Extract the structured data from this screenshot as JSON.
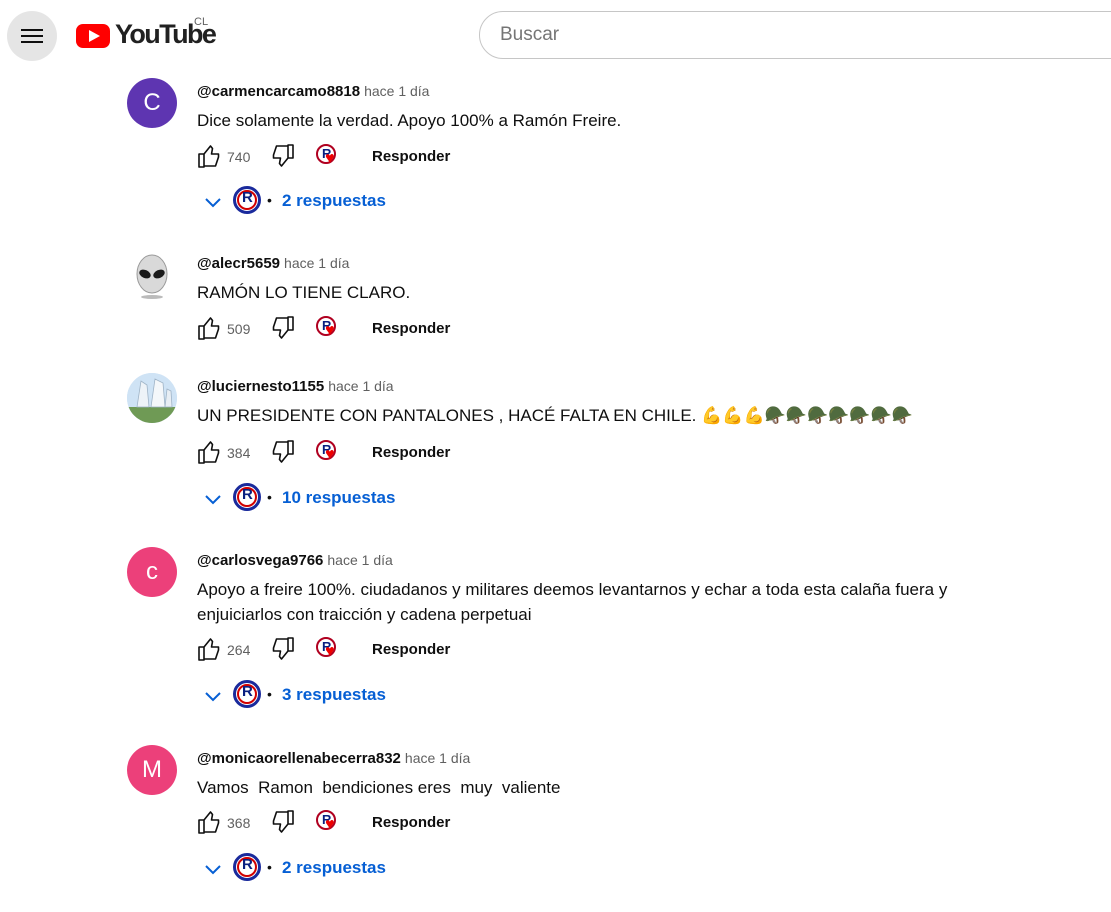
{
  "header": {
    "logo_text": "YouTube",
    "country_code": "CL",
    "search_placeholder": "Buscar"
  },
  "reply_button_label": "Responder",
  "icons": {
    "menu": "hamburger-icon",
    "like": "thumbs-up-icon",
    "dislike": "thumbs-down-icon",
    "creator_heart": "creator-heart-icon",
    "expand": "chevron-down-icon"
  },
  "colors": {
    "link": "#065fd4",
    "brand_red": "#ff0000",
    "avatar_purple": "#5e35b1",
    "avatar_pink": "#ec407a"
  },
  "comments": [
    {
      "author": "@carmencarcamo8818",
      "time": "hace 1 día",
      "avatar_letter": "C",
      "text": "Dice solamente la verdad. Apoyo 100% a Ramón Freire.",
      "likes": "740",
      "replies_label": "2 respuestas"
    },
    {
      "author": "@alecr5659",
      "time": "hace 1 día",
      "avatar_letter": "",
      "text": "RAMÓN LO TIENE CLARO.",
      "likes": "509",
      "replies_label": ""
    },
    {
      "author": "@luciernesto1155",
      "time": "hace 1 día",
      "avatar_letter": "",
      "text": "UN PRESIDENTE CON PANTALONES , HACÉ FALTA EN CHILE. 💪💪💪🪖🪖🪖🪖🪖🪖🪖",
      "likes": "384",
      "replies_label": "10 respuestas"
    },
    {
      "author": "@carlosvega9766",
      "time": "hace 1 día",
      "avatar_letter": "c",
      "text": "Apoyo a freire 100%. ciudadanos y militares deemos levantarnos y echar a toda esta calaña fuera y enjuiciarlos con traicción y cadena perpetuai",
      "likes": "264",
      "replies_label": "3 respuestas"
    },
    {
      "author": "@monicaorellenabecerra832",
      "time": "hace 1 día",
      "avatar_letter": "M",
      "text": "Vamos  Ramon  bendiciones eres  muy  valiente",
      "likes": "368",
      "replies_label": "2 respuestas"
    }
  ]
}
